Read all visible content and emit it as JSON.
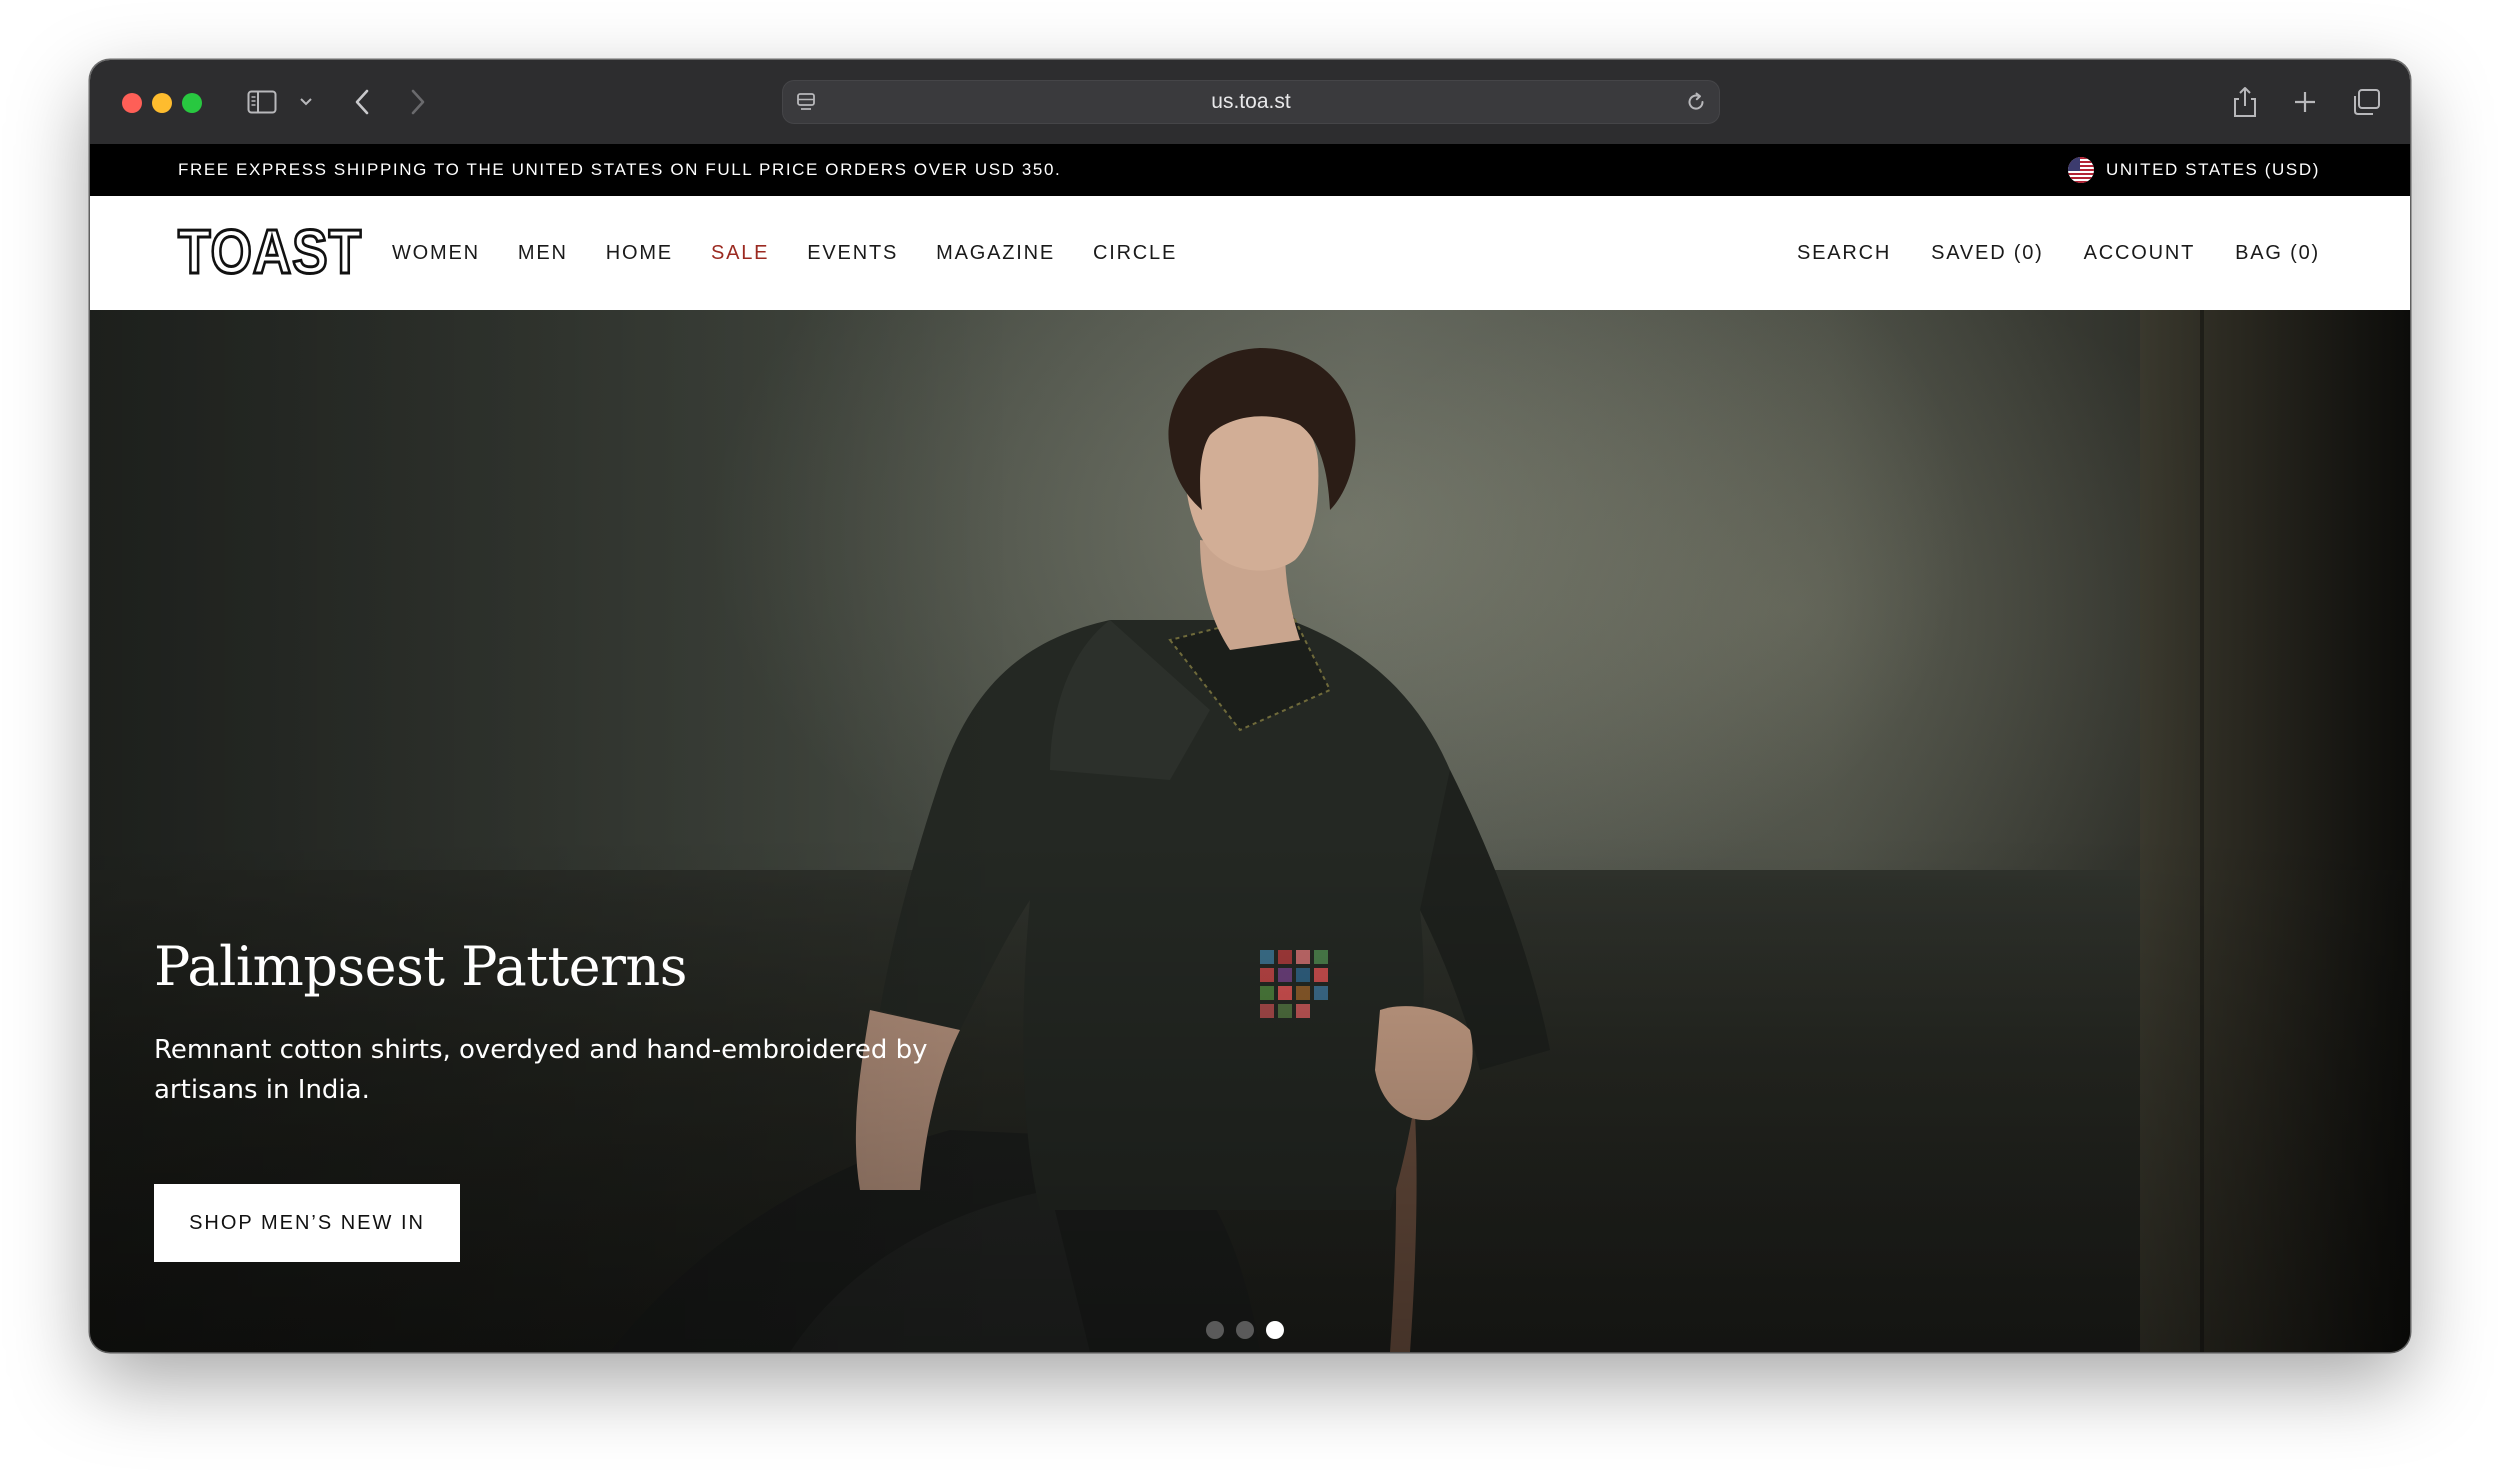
{
  "browser": {
    "url": "us.toa.st"
  },
  "promo": {
    "message": "FREE EXPRESS SHIPPING TO THE UNITED STATES ON FULL PRICE ORDERS OVER USD 350.",
    "region": "UNITED STATES (USD)"
  },
  "nav": {
    "logo": "TOAST",
    "menu": [
      "WOMEN",
      "MEN",
      "HOME",
      "SALE",
      "EVENTS",
      "MAGAZINE",
      "CIRCLE"
    ],
    "utility": [
      "SEARCH",
      "SAVED (0)",
      "ACCOUNT",
      "BAG (0)"
    ]
  },
  "hero": {
    "title": "Palimpsest Patterns",
    "subtitle": "Remnant cotton shirts, overdyed and hand-embroidered by artisans in India.",
    "cta": "SHOP MEN’S NEW IN",
    "slide_count": 3,
    "active_slide": 3
  },
  "colors": {
    "sale_accent": "#9b2a21",
    "promo_bg": "#000000",
    "toolbar_bg": "#2d2d2f"
  }
}
